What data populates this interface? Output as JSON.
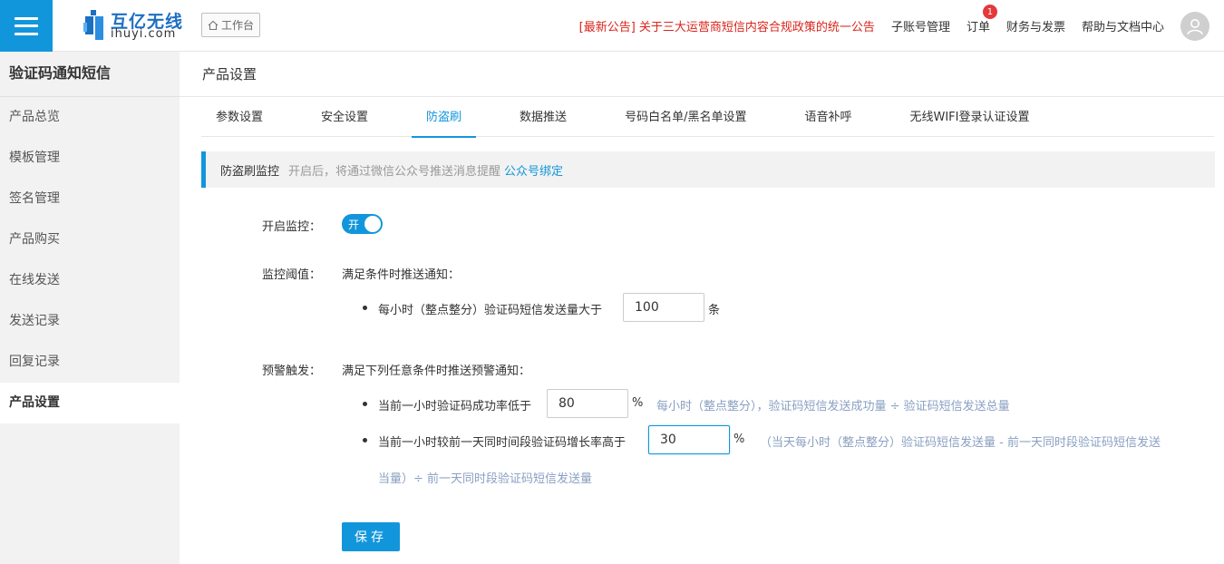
{
  "header": {
    "logo_cn": "互亿无线",
    "logo_en": "ihuyi.com",
    "workbench_label": "工作台",
    "notice": "[最新公告] 关于三大运营商短信内容合规政策的统一公告",
    "links": [
      {
        "label": "子账号管理"
      },
      {
        "label": "订单",
        "badge": "1"
      },
      {
        "label": "财务与发票"
      },
      {
        "label": "帮助与文档中心"
      }
    ]
  },
  "sidebar": {
    "title": "验证码通知短信",
    "items": [
      {
        "label": "产品总览"
      },
      {
        "label": "模板管理"
      },
      {
        "label": "签名管理"
      },
      {
        "label": "产品购买"
      },
      {
        "label": "在线发送"
      },
      {
        "label": "发送记录"
      },
      {
        "label": "回复记录"
      },
      {
        "label": "产品设置",
        "active": true
      }
    ]
  },
  "main": {
    "title": "产品设置",
    "tabs": [
      {
        "label": "参数设置"
      },
      {
        "label": "安全设置"
      },
      {
        "label": "防盗刷",
        "active": true
      },
      {
        "label": "数据推送"
      },
      {
        "label": "号码白名单/黑名单设置"
      },
      {
        "label": "语音补呼"
      },
      {
        "label": "无线WIFI登录认证设置"
      }
    ],
    "info": {
      "title": "防盗刷监控",
      "desc": "开启后，将通过微信公众号推送消息提醒",
      "link": "公众号绑定"
    },
    "form": {
      "monitor_label": "开启监控：",
      "switch_text": "开",
      "switch_on": true,
      "threshold_label": "监控阈值：",
      "threshold_desc": "满足条件时推送通知：",
      "threshold_rule": "每小时（整点整分）验证码短信发送量大于",
      "threshold_value": "100",
      "threshold_unit": "条",
      "alert_label": "预警触发：",
      "alert_desc": "满足下列任意条件时推送预警通知：",
      "rule1_text": "当前一小时验证码成功率低于",
      "rule1_value": "80",
      "rule1_unit": "%",
      "rule1_hint": "每小时（整点整分），验证码短信发送成功量 ÷ 验证码短信发送总量",
      "rule2_text": "当前一小时较前一天同时间段验证码增长率高于",
      "rule2_value": "30",
      "rule2_unit": "%",
      "rule2_hint_line1": "（当天每小时（整点整分）验证码短信发送量 - 前一天同时段验证码短信发送",
      "rule2_hint_line2": "当量）÷ 前一天同时段验证码短信发送量",
      "save_label": "保存"
    }
  },
  "colors": {
    "accent": "#1296db",
    "notice": "#d9251d",
    "hint": "#8aa0c2"
  }
}
